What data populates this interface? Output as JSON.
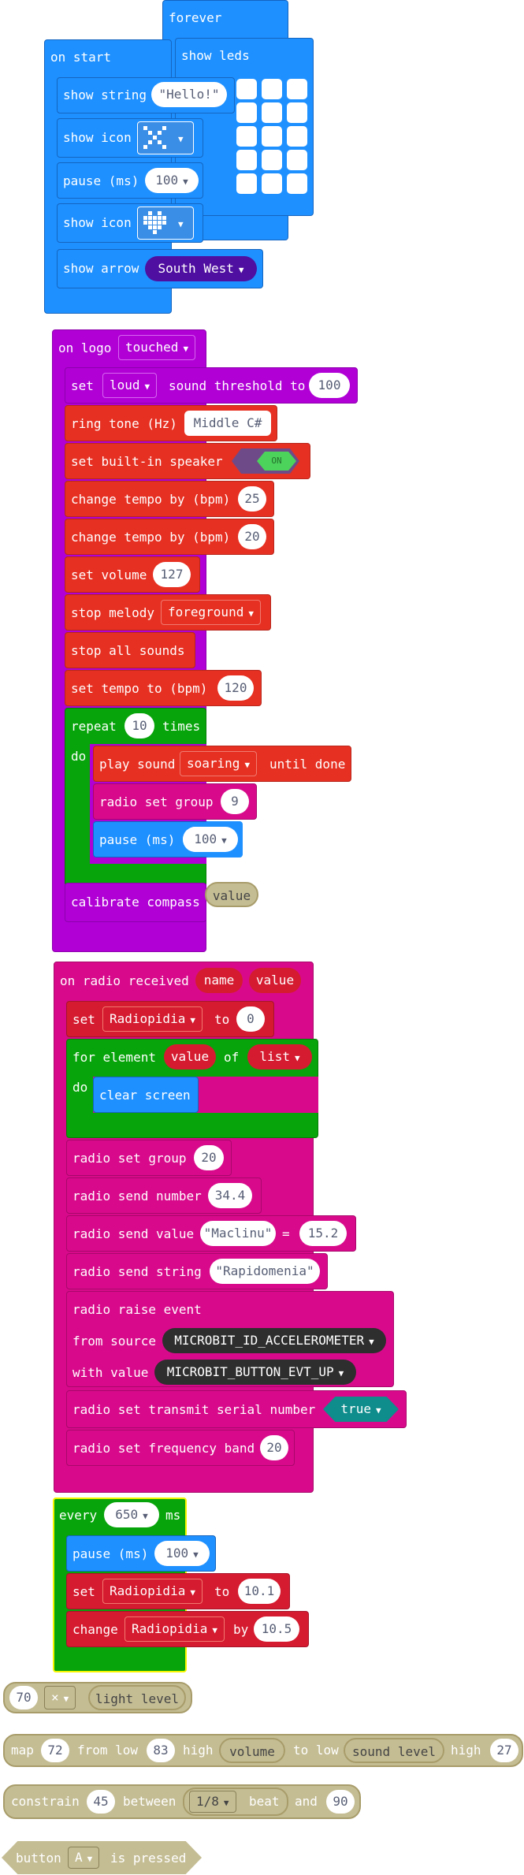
{
  "colors": {
    "basic": "#1e90ff",
    "input": "#b000d6",
    "music": "#e63022",
    "variables": "#d51b2f",
    "loops": "#08a40b",
    "radio": "#d80a8b",
    "arrow_value": "#4f0fa0",
    "math_value": "#c4bd94"
  },
  "forever_group": {
    "forever_label": "forever",
    "show_leds_label": "show leds"
  },
  "on_start": {
    "label": "on start",
    "show_string_label": "show string",
    "show_string_value": "\"Hello!\"",
    "show_icon_label": "show icon",
    "pause_label": "pause (ms)",
    "pause_value": "100",
    "show_icon2_label": "show icon",
    "show_arrow_label": "show arrow",
    "arrow_value": "South West"
  },
  "on_logo": {
    "label": "on logo",
    "event_value": "touched",
    "set_label": "set",
    "set_value": "loud",
    "threshold_label": "sound threshold to",
    "threshold_value": "100",
    "ring_tone_label": "ring tone (Hz)",
    "ring_tone_value": "Middle C#",
    "speaker_label": "set built-in speaker",
    "speaker_value": "ON",
    "change_tempo_label": "change tempo by (bpm)",
    "change_tempo_value1": "25",
    "change_tempo_value2": "20",
    "set_volume_label": "set volume",
    "set_volume_value": "127",
    "stop_melody_label": "stop melody",
    "stop_melody_value": "foreground",
    "stop_all_label": "stop all sounds",
    "set_tempo_label": "set tempo to (bpm)",
    "set_tempo_value": "120",
    "repeat_label": "repeat",
    "repeat_value": "10",
    "times_label": "times",
    "do_label": "do",
    "play_sound_label": "play sound",
    "play_sound_value": "soaring",
    "until_done_label": "until done",
    "radio_group_label": "radio set group",
    "radio_group_value": "9",
    "inner_pause_label": "pause (ms)",
    "inner_pause_value": "100",
    "calibrate_label": "calibrate compass",
    "floating_value": "value"
  },
  "on_radio": {
    "label": "on radio received",
    "param1": "name",
    "param2": "value",
    "set_label": "set",
    "set_var": "Radiopidia",
    "to_label": "to",
    "set_value": "0",
    "for_label": "for element",
    "for_var": "value",
    "of_label": "of",
    "for_list": "list",
    "do_label": "do",
    "clear_label": "clear screen",
    "group_label": "radio set group",
    "group_value": "20",
    "send_number_label": "radio send number",
    "send_number_value": "34.4",
    "send_value_label": "radio send value",
    "send_value_name": "\"Maclinu\"",
    "send_value_eq": "=",
    "send_value_value": "15.2",
    "send_string_label": "radio send string",
    "send_string_value": "\"Rapidomenia\"",
    "raise_label": "radio raise event",
    "from_label": "from source",
    "from_value": "MICROBIT_ID_ACCELEROMETER",
    "with_label": "with value",
    "with_value": "MICROBIT_BUTTON_EVT_UP",
    "serial_label": "radio set transmit serial number",
    "serial_value": "true",
    "band_label": "radio set frequency band",
    "band_value": "20"
  },
  "every": {
    "label": "every",
    "interval": "650",
    "ms_label": "ms",
    "pause_label": "pause (ms)",
    "pause_value": "100",
    "set_label": "set",
    "set_var": "Radiopidia",
    "to_label": "to",
    "set_value": "10.1",
    "change_label": "change",
    "change_var": "Radiopidia",
    "by_label": "by",
    "change_value": "10.5"
  },
  "loose": {
    "mult_left": "70",
    "mult_op": "×",
    "mult_right": "light level",
    "map_label": "map",
    "map_value": "72",
    "from_low_label": "from low",
    "from_low_value": "83",
    "high_label": "high",
    "high_value": "volume",
    "to_low_label": "to low",
    "to_low_value": "sound level",
    "high2_label": "high",
    "high2_value": "27",
    "constrain_label": "constrain",
    "constrain_value": "45",
    "between_label": "between",
    "beat_value": "1/8",
    "beat_label": "beat",
    "and_label": "and",
    "and_value": "90",
    "button_label": "button",
    "button_value": "A",
    "pressed_label": "is pressed"
  }
}
